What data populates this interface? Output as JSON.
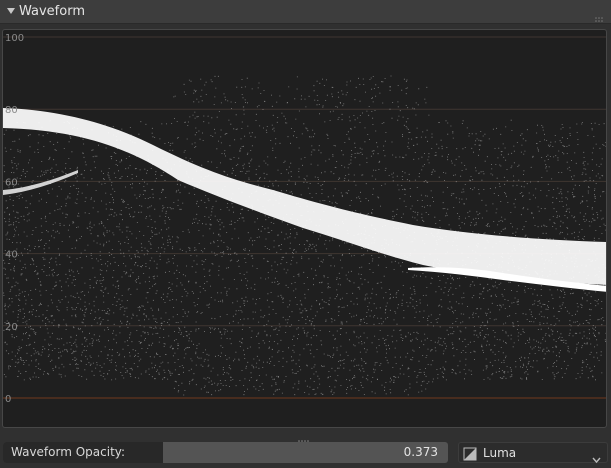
{
  "panel": {
    "title": "Waveform",
    "expanded": true
  },
  "scope": {
    "scale_labels": [
      "100",
      "80",
      "60",
      "40",
      "20",
      "0"
    ],
    "grid_color": "#5a4a40",
    "baseline_color": "#7a3e1c",
    "trace_color": "#ffffff"
  },
  "opacity": {
    "label": "Waveform Opacity:",
    "value": "0.373",
    "fraction": 0.373
  },
  "mode": {
    "label": "Luma",
    "icon": "color-mode-icon"
  },
  "icons": {
    "collapse": "disclosure-triangle-down-icon",
    "drag": "drag-grip-icon",
    "resize": "resize-grip-icon",
    "dropdown": "chevron-down-icon"
  }
}
